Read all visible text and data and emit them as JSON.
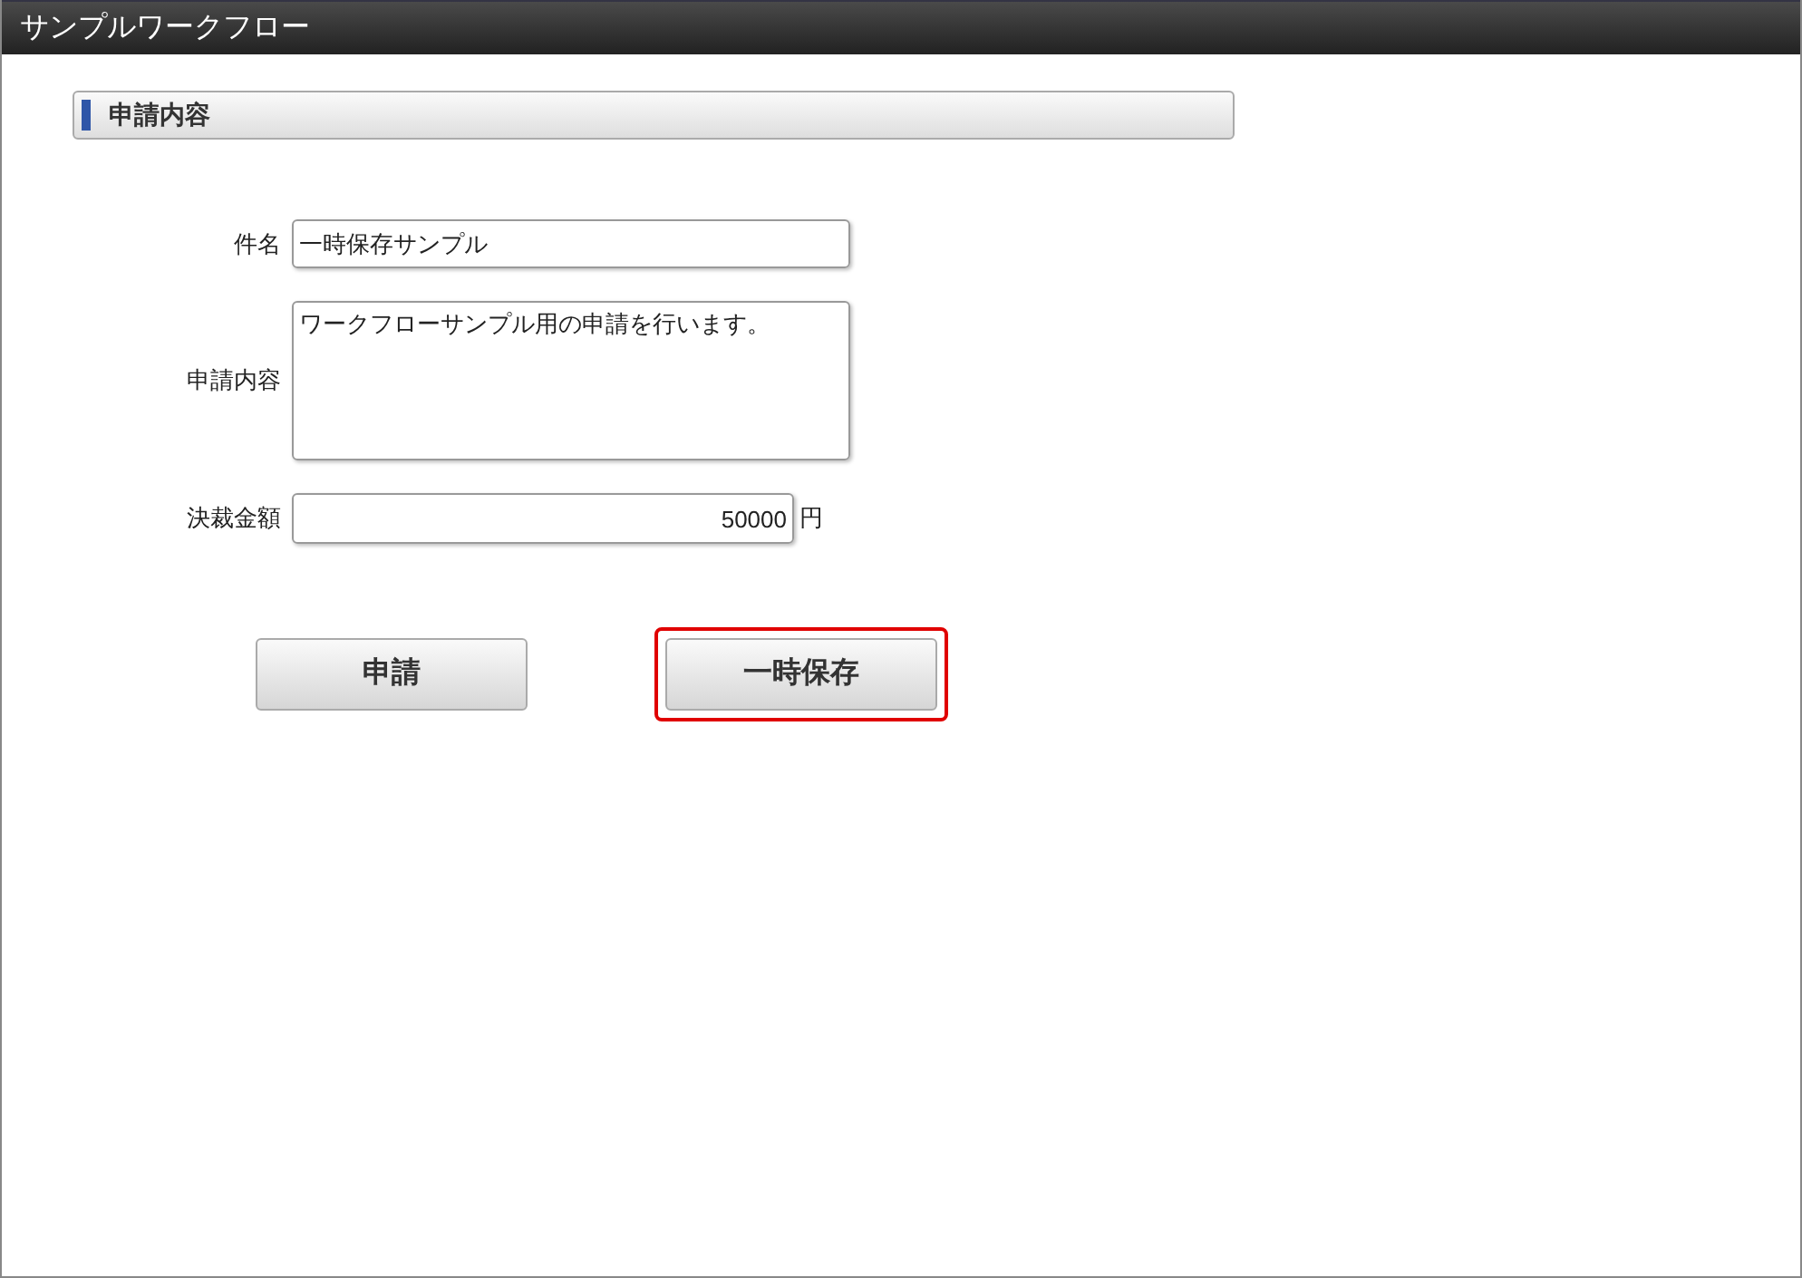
{
  "window": {
    "title": "サンプルワークフロー"
  },
  "section": {
    "title": "申請内容"
  },
  "fields": [
    {
      "kind": "input",
      "label": "件名",
      "value": "一時保存サンプル"
    },
    {
      "kind": "textarea",
      "label": "申請内容",
      "value": "ワークフローサンプル用の申請を行います。"
    },
    {
      "kind": "amount",
      "label": "決裁金額",
      "value": "50000",
      "unit": "円"
    }
  ],
  "buttons": [
    {
      "label": "申請",
      "highlighted": false
    },
    {
      "label": "一時保存",
      "highlighted": true
    }
  ]
}
